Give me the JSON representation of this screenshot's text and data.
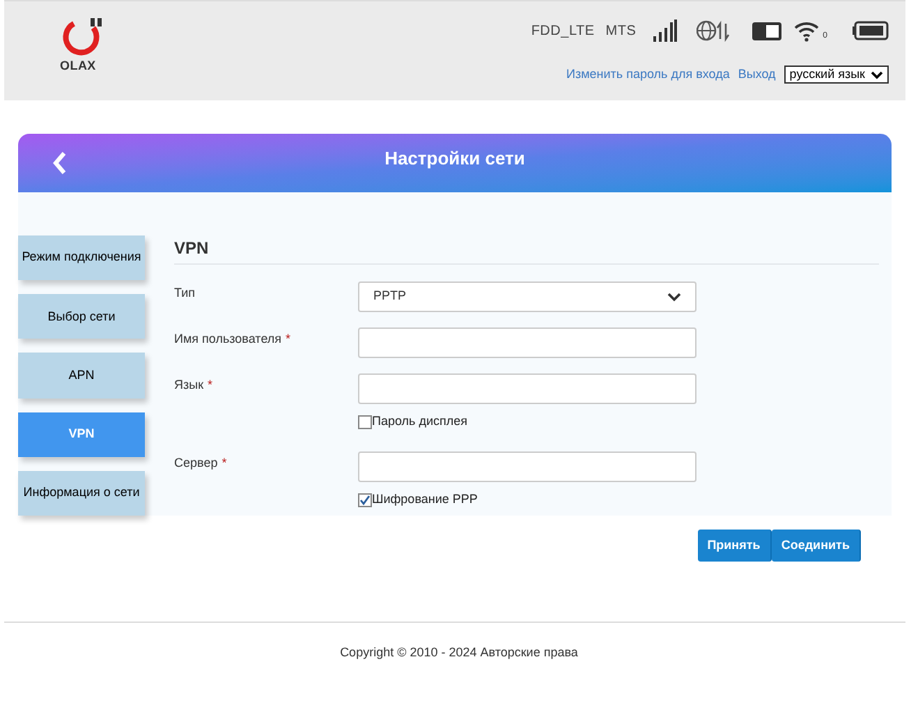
{
  "logo": {
    "text": "OLAX"
  },
  "header": {
    "wifi_clients": "0",
    "network_type": "FDD_LTE",
    "operator": "MTS",
    "links": [
      "Изменить пароль для входа",
      "Выход"
    ],
    "language": "русский язык"
  },
  "page": {
    "title": "Настройки сети"
  },
  "sidebar": {
    "items": [
      {
        "label": "Режим подключения",
        "selected": false
      },
      {
        "label": "Выбор сети",
        "selected": false
      },
      {
        "label": "APN",
        "selected": false
      },
      {
        "label": "VPN",
        "selected": true
      },
      {
        "label": "Информация о сети",
        "selected": false
      }
    ]
  },
  "form": {
    "title": "VPN",
    "fields": [
      {
        "kind": "select",
        "label": "Тип",
        "value": "PPTP"
      },
      {
        "kind": "text",
        "label": "Имя пользователя",
        "required_mark": "*"
      },
      {
        "kind": "text",
        "label": "Язык",
        "required_mark": "*"
      },
      {
        "kind": "checkbox",
        "label": "Пароль дисплея",
        "checked": false
      },
      {
        "kind": "text",
        "label": "Сервер",
        "required_mark": "*"
      },
      {
        "kind": "checkbox",
        "label": "Шифрование PPP",
        "checked": true
      }
    ],
    "buttons": [
      "Принять",
      "Соединить"
    ]
  },
  "footer": {
    "copyright": "Copyright © 2010 - 2024 Авторские права"
  }
}
